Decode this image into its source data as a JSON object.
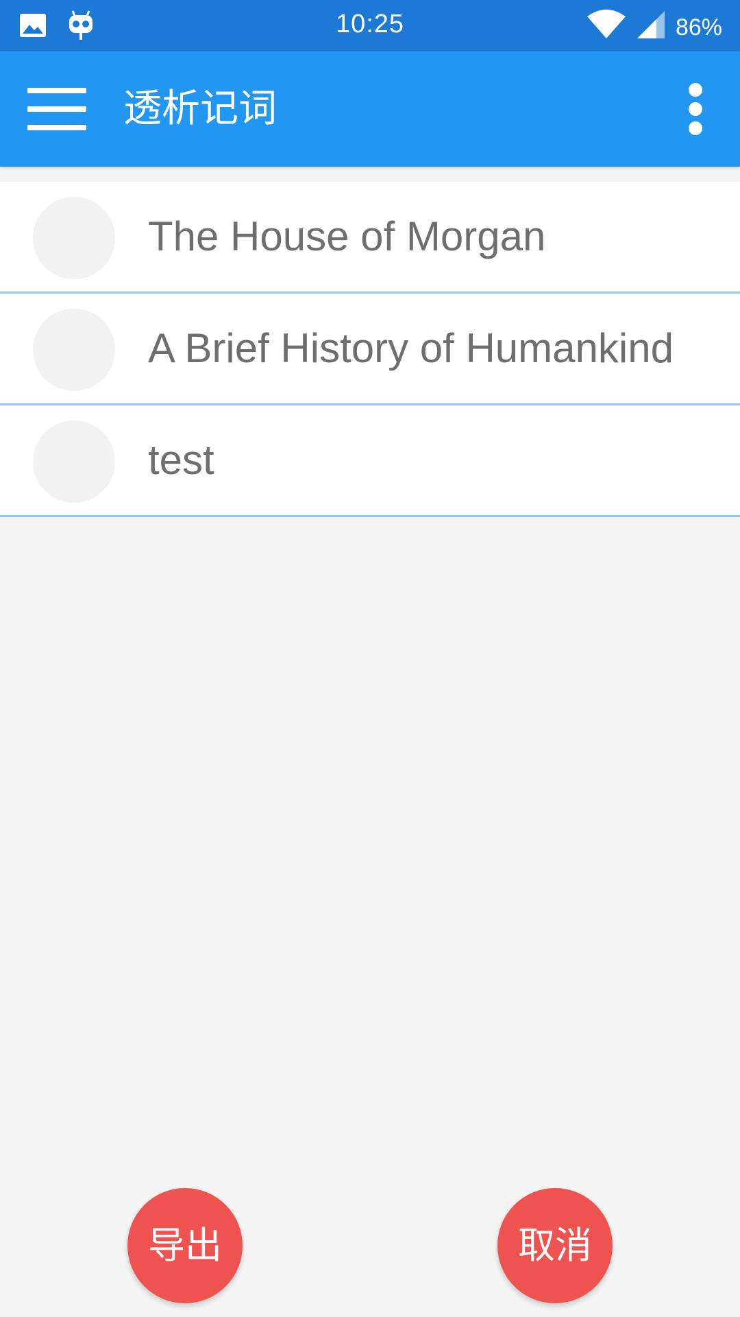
{
  "status_bar": {
    "time": "10:25",
    "battery": "86%",
    "left_icons": [
      "image-icon",
      "cyanogen-bot-icon"
    ],
    "right_icons": [
      "wifi-icon",
      "cell-signal-icon"
    ]
  },
  "app_bar": {
    "title": "透析记词",
    "menu_icon": "hamburger-menu-icon",
    "overflow_icon": "more-vert-icon",
    "color": "#2196f3"
  },
  "books": [
    {
      "title": "The House of Morgan"
    },
    {
      "title": "A Brief History of Humankind"
    },
    {
      "title": "test"
    }
  ],
  "actions": {
    "export_label": "导出",
    "cancel_label": "取消",
    "color": "#ef5350"
  }
}
